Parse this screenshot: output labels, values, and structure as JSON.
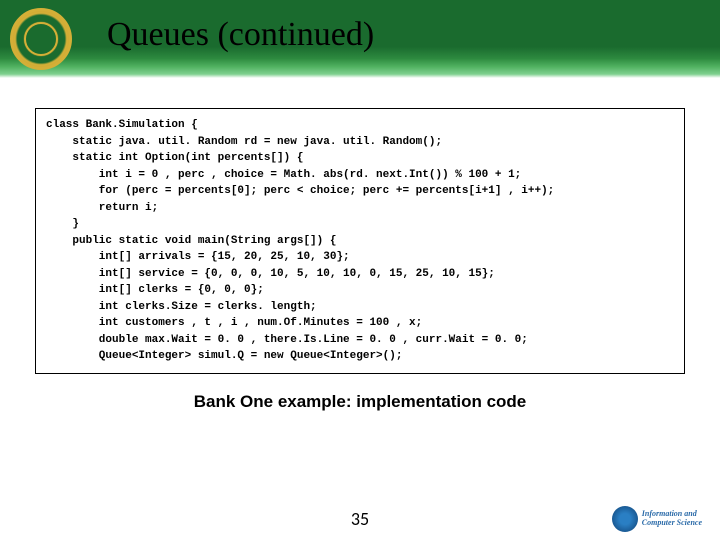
{
  "header": {
    "title": "Queues (continued)"
  },
  "code": {
    "lines": [
      "class Bank.Simulation {",
      "    static java. util. Random rd = new java. util. Random();",
      "    static int Option(int percents[]) {",
      "        int i = 0 , perc , choice = Math. abs(rd. next.Int()) % 100 + 1;",
      "        for (perc = percents[0]; perc < choice; perc += percents[i+1] , i++);",
      "        return i;",
      "    }",
      "    public static void main(String args[]) {",
      "        int[] arrivals = {15, 20, 25, 10, 30};",
      "        int[] service = {0, 0, 0, 10, 5, 10, 10, 0, 15, 25, 10, 15};",
      "        int[] clerks = {0, 0, 0};",
      "        int clerks.Size = clerks. length;",
      "        int customers , t , i , num.Of.Minutes = 100 , x;",
      "        double max.Wait = 0. 0 , there.Is.Line = 0. 0 , curr.Wait = 0. 0;",
      "        Queue<Integer> simul.Q = new Queue<Integer>();"
    ]
  },
  "caption": "Bank One example: implementation code",
  "footer": {
    "page": "35",
    "dept_line1": "Information and",
    "dept_line2": "Computer Science"
  }
}
